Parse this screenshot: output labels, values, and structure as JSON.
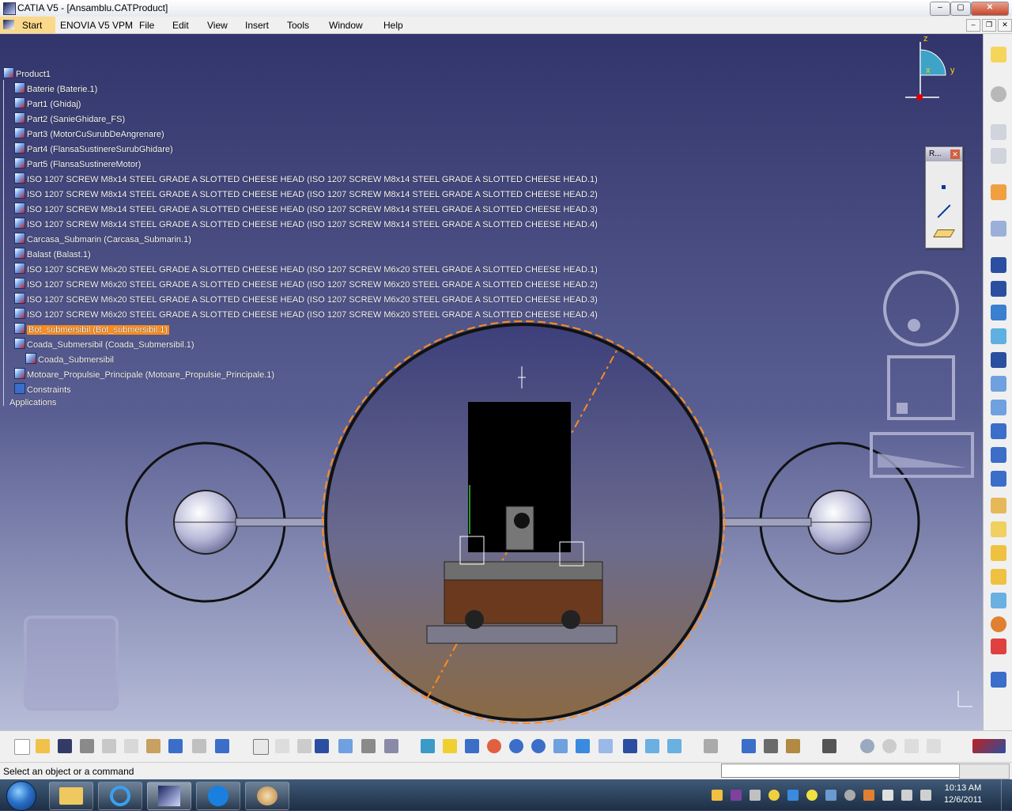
{
  "window": {
    "title": "CATIA V5 - [Ansamblu.CATProduct]",
    "minimize": "–",
    "maximize": "▢",
    "close": "✕"
  },
  "menubar": {
    "items": [
      "Start",
      "ENOVIA V5 VPM",
      "File",
      "Edit",
      "View",
      "Insert",
      "Tools",
      "Window",
      "Help"
    ],
    "mdi_minimize": "–",
    "mdi_restore": "❐",
    "mdi_close": "✕"
  },
  "tree": {
    "root": "Product1",
    "nodes": [
      "Baterie (Baterie.1)",
      "Part1 (Ghidaj)",
      "Part2 (SanieGhidare_FS)",
      "Part3 (MotorCuSurubDeAngrenare)",
      "Part4 (FlansaSustinereSurubGhidare)",
      "Part5 (FlansaSustinereMotor)",
      "ISO 1207 SCREW M8x14 STEEL GRADE A SLOTTED CHEESE HEAD (ISO 1207 SCREW M8x14 STEEL GRADE A SLOTTED CHEESE HEAD.1)",
      "ISO 1207 SCREW M8x14 STEEL GRADE A SLOTTED CHEESE HEAD (ISO 1207 SCREW M8x14 STEEL GRADE A SLOTTED CHEESE HEAD.2)",
      "ISO 1207 SCREW M8x14 STEEL GRADE A SLOTTED CHEESE HEAD (ISO 1207 SCREW M8x14 STEEL GRADE A SLOTTED CHEESE HEAD.3)",
      "ISO 1207 SCREW M8x14 STEEL GRADE A SLOTTED CHEESE HEAD (ISO 1207 SCREW M8x14 STEEL GRADE A SLOTTED CHEESE HEAD.4)",
      "Carcasa_Submarin (Carcasa_Submarin.1)",
      "Balast (Balast.1)",
      "ISO 1207 SCREW M6x20 STEEL GRADE A SLOTTED CHEESE HEAD (ISO 1207 SCREW M6x20 STEEL GRADE A SLOTTED CHEESE HEAD.1)",
      "ISO 1207 SCREW M6x20 STEEL GRADE A SLOTTED CHEESE HEAD (ISO 1207 SCREW M6x20 STEEL GRADE A SLOTTED CHEESE HEAD.2)",
      "ISO 1207 SCREW M6x20 STEEL GRADE A SLOTTED CHEESE HEAD (ISO 1207 SCREW M6x20 STEEL GRADE A SLOTTED CHEESE HEAD.3)",
      "ISO 1207 SCREW M6x20 STEEL GRADE A SLOTTED CHEESE HEAD (ISO 1207 SCREW M6x20 STEEL GRADE A SLOTTED CHEESE HEAD.4)",
      "Bot_submersibil (Bot_submersibil.1)",
      "Coada_Submersibil (Coada_Submersibil.1)",
      "Coada_Submersibil",
      "Motoare_Propulsie_Principale (Motoare_Propulsie_Principale.1)",
      "Constraints",
      "Applications"
    ],
    "selected": "Bot_submersibil (Bot_submersibil.1)"
  },
  "compass": {
    "z": "z",
    "x": "x",
    "y": "y"
  },
  "float_panel": {
    "title": "R...",
    "close": "✕"
  },
  "status": {
    "message": "Select an object or a command",
    "command_input": ""
  },
  "taskbar": {
    "time": "10:13 AM",
    "date": "12/6/2011"
  },
  "colors": {
    "selection": "#ff8c1a",
    "viewport_top": "#32356b",
    "viewport_bottom": "#b7bdd8"
  }
}
